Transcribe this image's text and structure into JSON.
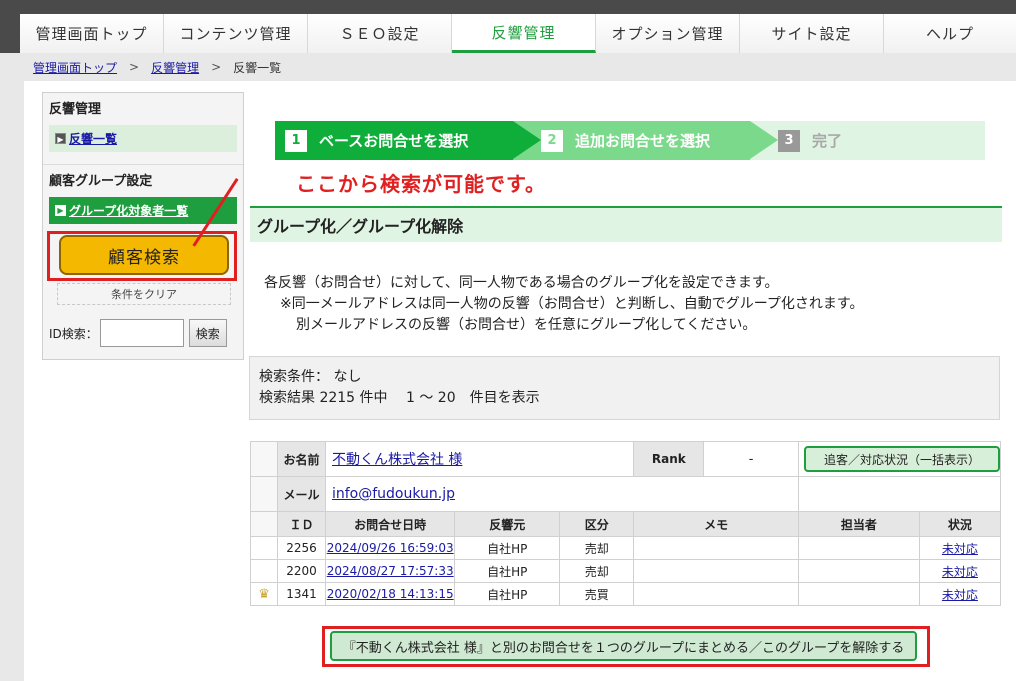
{
  "nav": {
    "items": [
      "管理画面トップ",
      "コンテンツ管理",
      "ＳＥＯ設定",
      "反響管理",
      "オプション管理",
      "サイト設定",
      "ヘルプ"
    ]
  },
  "breadcrumb": {
    "home": "管理画面トップ",
    "section": "反響管理",
    "current": "反響一覧",
    "sep": ">"
  },
  "sidebar": {
    "heading1": "反響管理",
    "link1": "反響一覧",
    "heading2": "顧客グループ設定",
    "link2": "グループ化対象者一覧",
    "search_button": "顧客検索",
    "clear_button": "条件をクリア",
    "id_label": "ID検索：",
    "id_button": "検索"
  },
  "annotation": "ここから検索が可能です。",
  "steps": [
    {
      "num": "1",
      "label": "ベースお問合せを選択"
    },
    {
      "num": "2",
      "label": "追加お問合せを選択"
    },
    {
      "num": "3",
      "label": "完了"
    }
  ],
  "section_title": "グループ化／グループ化解除",
  "description": [
    "各反響（お問合せ）に対して、同一人物である場合のグループ化を設定できます。",
    "※同一メールアドレスは同一人物の反響（お問合せ）と判断し、自動でグループ化されます。",
    "別メールアドレスの反響（お問合せ）を任意にグループ化してください。"
  ],
  "conditions": {
    "line1": "検索条件：  なし",
    "line2": "検索結果 2215 件中　 1 ～ 20　件目を表示"
  },
  "result": {
    "name_label": "お名前",
    "name_value": "不動くん株式会社 様",
    "rank_label": "Rank",
    "rank_value": "-",
    "status_button": "追客／対応状況（一括表示）",
    "mail_label": "メール",
    "mail_value": "info@fudoukun.jp",
    "headers": [
      "ＩＤ",
      "お問合せ日時",
      "反響元",
      "区分",
      "メモ",
      "担当者",
      "状況"
    ],
    "rows": [
      {
        "id": "2256",
        "date": "2024/09/26 16:59:03",
        "source": "自社HP",
        "kind": "売却",
        "memo": "",
        "staff": "",
        "status": "未対応"
      },
      {
        "id": "2200",
        "date": "2024/08/27 17:57:33",
        "source": "自社HP",
        "kind": "売却",
        "memo": "",
        "staff": "",
        "status": "未対応"
      },
      {
        "id": "1341",
        "date": "2020/02/18 14:13:15",
        "source": "自社HP",
        "kind": "売買",
        "memo": "",
        "staff": "",
        "status": "未対応"
      }
    ],
    "crown_icon": "♛"
  },
  "group_button": "『不動くん株式会社 様』と別のお問合せを１つのグループにまとめる／このグループを解除する"
}
